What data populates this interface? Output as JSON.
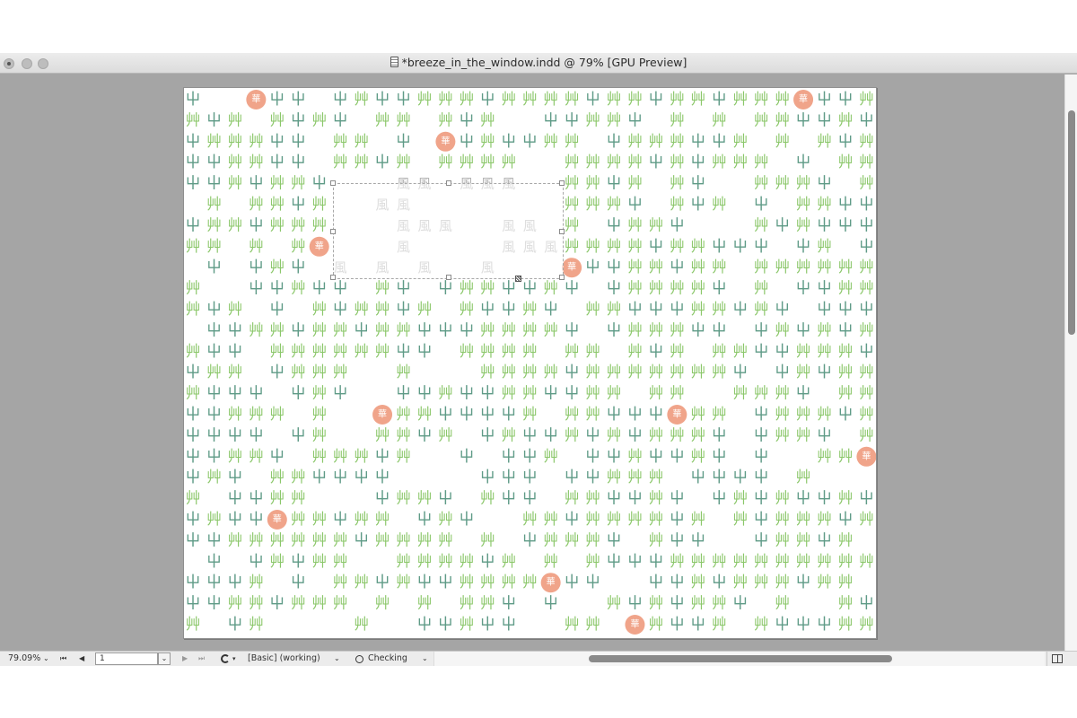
{
  "window": {
    "title": "*breeze_in_the_window.indd @ 79% [GPU Preview]"
  },
  "layout": {
    "colors": {
      "page": "#ffffff",
      "pasteboard": "#a5a5a5",
      "sprout_dark": "#5f9b87",
      "grass_green": "#8bc76a",
      "flower_fill": "#f0a48a",
      "flower_text": "#ffffff",
      "wind_gray": "#b3b3b3"
    }
  },
  "artwork": {
    "glyph_sprout": "屮",
    "glyph_grass": "艸",
    "glyph_flower": "華",
    "glyph_wind": "風"
  },
  "status": {
    "zoom": "79.09%",
    "page_number": "1",
    "preflight_profile": "[Basic] (working)",
    "preflight_status": "Checking"
  }
}
